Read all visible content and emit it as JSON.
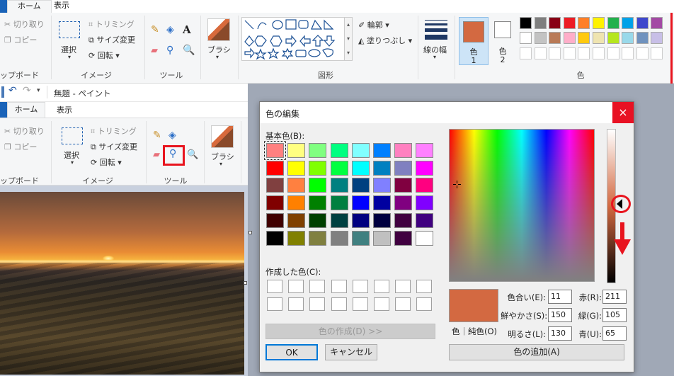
{
  "top_ribbon": {
    "tabs": [
      "ホーム",
      "表示"
    ],
    "clipboard": {
      "cut": "切り取り",
      "copy": "コピー",
      "group": "ップボード"
    },
    "image": {
      "select": "選択",
      "crop": "トリミング",
      "resize": "サイズ変更",
      "rotate": "回転",
      "group": "イメージ"
    },
    "tools": {
      "group": "ツール"
    },
    "brushes": {
      "label": "ブラシ"
    },
    "shapes": {
      "outline": "輪郭",
      "fill": "塗りつぶし",
      "group": "図形"
    },
    "size": {
      "label": "線の幅"
    },
    "color1": {
      "label": "色",
      "num": "1"
    },
    "color2": {
      "label": "色",
      "num": "2"
    },
    "colors_group": "色",
    "palette_row1": [
      "#000000",
      "#7f7f7f",
      "#880015",
      "#ed1c24",
      "#ff7f27",
      "#fff200",
      "#22b14c",
      "#00a2e8",
      "#3f48cc",
      "#a349a4"
    ],
    "palette_row2": [
      "#ffffff",
      "#c3c3c3",
      "#b97a57",
      "#ffaec9",
      "#ffc90e",
      "#efe4b0",
      "#b5e61d",
      "#99d9ea",
      "#7092be",
      "#c8bfe7"
    ]
  },
  "paint_window": {
    "title": "無題 - ペイント",
    "tabs": [
      "ホーム",
      "表示"
    ],
    "clipboard": {
      "cut": "切り取り",
      "copy": "コピー",
      "group": "ップボード"
    },
    "image": {
      "select": "選択",
      "crop": "トリミング",
      "resize": "サイズ変更",
      "rotate": "回転",
      "group": "イメージ"
    },
    "tools": {
      "group": "ツール"
    },
    "brushes": {
      "label": "ブラシ"
    }
  },
  "dialog": {
    "title": "色の編集",
    "basic_colors_label": "基本色(B):",
    "basic_colors": [
      [
        "#ff8080",
        "#ffff80",
        "#80ff80",
        "#00ff80",
        "#80ffff",
        "#0080ff",
        "#ff80c0",
        "#ff80ff"
      ],
      [
        "#ff0000",
        "#ffff00",
        "#80ff00",
        "#00ff40",
        "#00ffff",
        "#0080c0",
        "#8080c0",
        "#ff00ff"
      ],
      [
        "#804040",
        "#ff8040",
        "#00ff00",
        "#008080",
        "#004080",
        "#8080ff",
        "#800040",
        "#ff0080"
      ],
      [
        "#800000",
        "#ff8000",
        "#008000",
        "#008040",
        "#0000ff",
        "#0000a0",
        "#800080",
        "#8000ff"
      ],
      [
        "#400000",
        "#804000",
        "#004000",
        "#004040",
        "#000080",
        "#000040",
        "#400040",
        "#400080"
      ],
      [
        "#000000",
        "#808000",
        "#808040",
        "#808080",
        "#408080",
        "#c0c0c0",
        "#400040",
        "#ffffff"
      ]
    ],
    "custom_colors_label": "作成した色(C):",
    "define_button": "色の作成(D) >>",
    "ok_button": "OK",
    "cancel_button": "キャンセル",
    "preview_label": "色｜純色(O)",
    "preview_color": "#d36941",
    "hue_label": "色合い(E):",
    "hue_value": "11",
    "sat_label": "鮮やかさ(S):",
    "sat_value": "150",
    "lum_label": "明るさ(L):",
    "lum_value": "130",
    "red_label": "赤(R):",
    "red_value": "211",
    "green_label": "緑(G):",
    "green_value": "105",
    "blue_label": "青(U):",
    "blue_value": "65",
    "add_button": "色の追加(A)",
    "close_icon": "×"
  },
  "annotation_color": "#e8141e",
  "luminance_level_fraction": 0.49
}
